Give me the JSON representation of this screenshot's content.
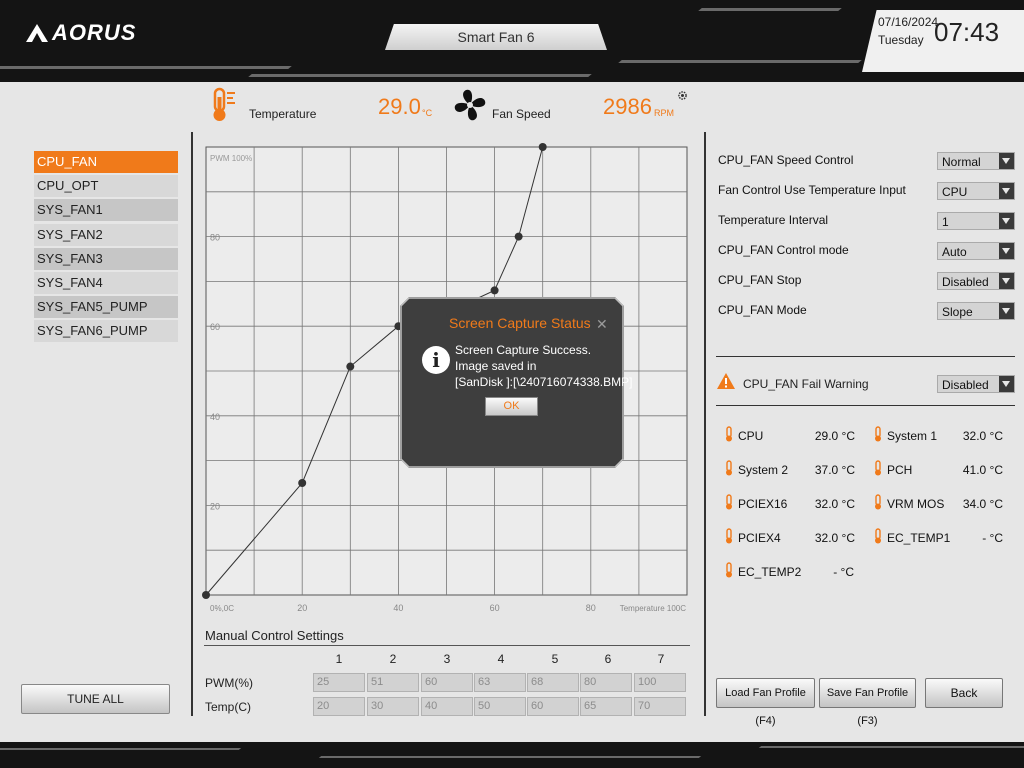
{
  "brand": "AORUS",
  "window": {
    "title": "Smart Fan 6"
  },
  "datetime": {
    "date": "07/16/2024",
    "day": "Tuesday",
    "time": "07:43"
  },
  "readouts": {
    "temperature_label": "Temperature",
    "temperature_value": "29.0",
    "temperature_unit": "°C",
    "fan_speed_label": "Fan Speed",
    "fan_speed_value": "2986",
    "fan_speed_unit": "RPM"
  },
  "fans": [
    "CPU_FAN",
    "CPU_OPT",
    "SYS_FAN1",
    "SYS_FAN2",
    "SYS_FAN3",
    "SYS_FAN4",
    "SYS_FAN5_PUMP",
    "SYS_FAN6_PUMP"
  ],
  "active_fan": "CPU_FAN",
  "tune_all_label": "TUNE ALL",
  "chart_data": {
    "type": "line",
    "ylabel": "PWM 100%",
    "xlabel": "Temperature 100C",
    "origin_label": "0%,0C",
    "xlim": [
      0,
      100
    ],
    "ylim": [
      0,
      100
    ],
    "x_ticks": [
      20,
      40,
      60,
      80
    ],
    "y_ticks": [
      20,
      40,
      60,
      80
    ],
    "x": [
      0,
      20,
      30,
      40,
      50,
      60,
      65,
      70
    ],
    "y": [
      0,
      25,
      51,
      60,
      63,
      68,
      80,
      100
    ]
  },
  "manual": {
    "title": "Manual Control Settings",
    "columns": [
      "1",
      "2",
      "3",
      "4",
      "5",
      "6",
      "7"
    ],
    "pwm_label": "PWM(%)",
    "temp_label": "Temp(C)",
    "pwm": [
      "25",
      "51",
      "60",
      "63",
      "68",
      "80",
      "100"
    ],
    "temp": [
      "20",
      "30",
      "40",
      "50",
      "60",
      "65",
      "70"
    ]
  },
  "settings": [
    {
      "label": "CPU_FAN Speed Control",
      "value": "Normal"
    },
    {
      "label": "Fan Control Use Temperature Input",
      "value": "CPU"
    },
    {
      "label": "Temperature Interval",
      "value": "1"
    },
    {
      "label": "CPU_FAN Control mode",
      "value": "Auto"
    },
    {
      "label": "CPU_FAN Stop",
      "value": "Disabled"
    },
    {
      "label": "CPU_FAN Mode",
      "value": "Slope"
    }
  ],
  "fail_warning": {
    "label": "CPU_FAN Fail Warning",
    "value": "Disabled"
  },
  "sensors": [
    {
      "name": "CPU",
      "value": "29.0 °C"
    },
    {
      "name": "System 1",
      "value": "32.0 °C"
    },
    {
      "name": "System 2",
      "value": "37.0 °C"
    },
    {
      "name": "PCH",
      "value": "41.0 °C"
    },
    {
      "name": "PCIEX16",
      "value": "32.0 °C"
    },
    {
      "name": "VRM MOS",
      "value": "34.0 °C"
    },
    {
      "name": "PCIEX4",
      "value": "32.0 °C"
    },
    {
      "name": "EC_TEMP1",
      "value": "- °C"
    },
    {
      "name": "EC_TEMP2",
      "value": "- °C"
    }
  ],
  "buttons": {
    "load": "Load Fan Profile (F4)",
    "save": "Save Fan Profile (F3)",
    "back": "Back"
  },
  "dialog": {
    "title": "Screen Capture Status",
    "line1": "Screen Capture Success.",
    "line2": "Image saved in",
    "line3": "[SanDisk ]:[\\240716074338.BMP]",
    "ok": "OK"
  },
  "colors": {
    "accent": "#f07a1a",
    "dialog_bg": "#3e3e3e",
    "grid": "#777777",
    "curve": "#333333"
  }
}
